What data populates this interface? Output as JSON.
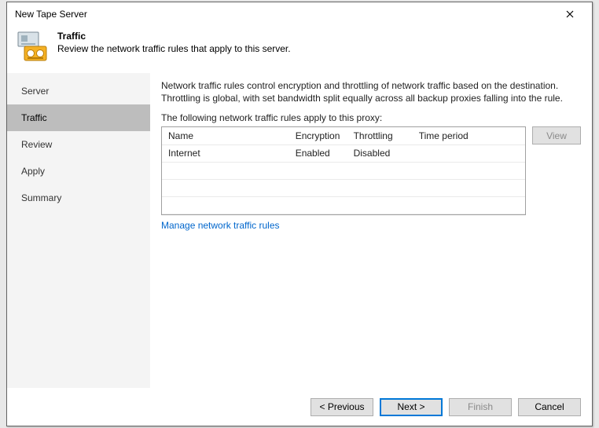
{
  "window": {
    "title": "New Tape Server"
  },
  "header": {
    "title": "Traffic",
    "subtitle": "Review the network traffic rules that apply to this server."
  },
  "sidebar": {
    "items": [
      {
        "label": "Server",
        "active": false
      },
      {
        "label": "Traffic",
        "active": true
      },
      {
        "label": "Review",
        "active": false
      },
      {
        "label": "Apply",
        "active": false
      },
      {
        "label": "Summary",
        "active": false
      }
    ]
  },
  "main": {
    "description": "Network traffic rules control encryption and throttling of network traffic based on the destination. Throttling is global, with set bandwidth split equally across all backup proxies falling into the rule.",
    "table_caption": "The following network traffic rules apply to this proxy:",
    "columns": {
      "name": "Name",
      "encryption": "Encryption",
      "throttling": "Throttling",
      "time_period": "Time period"
    },
    "rows": [
      {
        "name": "Internet",
        "encryption": "Enabled",
        "throttling": "Disabled",
        "time_period": ""
      }
    ],
    "view_button": "View",
    "manage_link": "Manage network traffic rules"
  },
  "footer": {
    "previous": "< Previous",
    "next": "Next >",
    "finish": "Finish",
    "cancel": "Cancel"
  }
}
